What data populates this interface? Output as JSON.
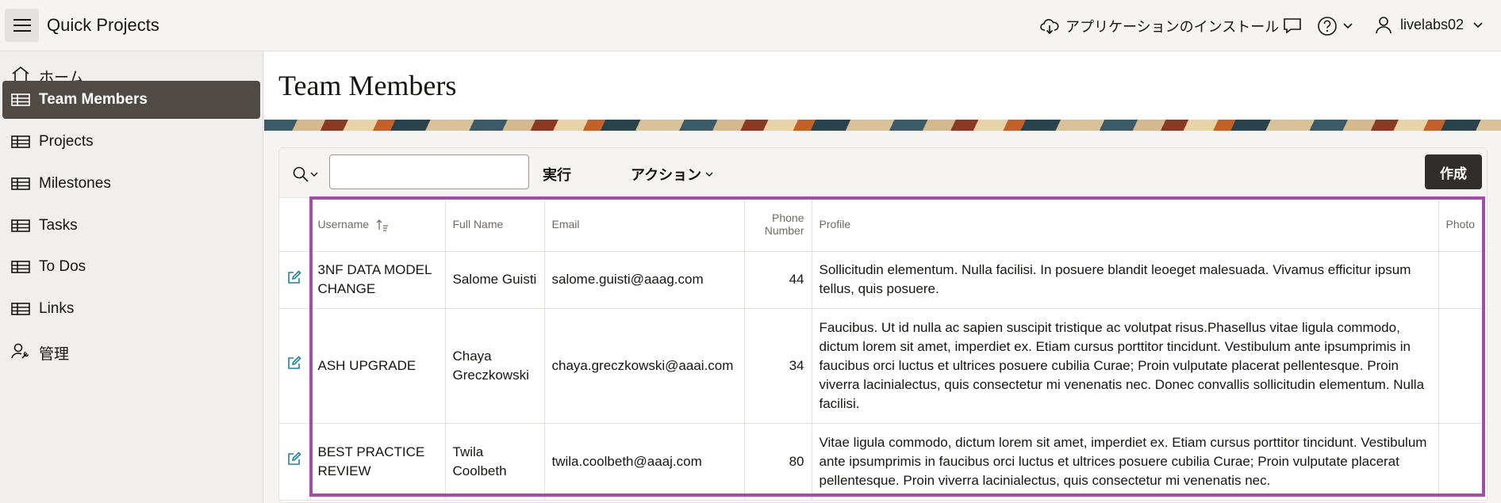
{
  "header": {
    "app_title": "Quick Projects",
    "install_label": "アプリケーションのインストール",
    "username": "livelabs02"
  },
  "sidebar": {
    "items": [
      {
        "label": "ホーム",
        "icon": "home-icon",
        "active": false
      },
      {
        "label": "Team Members",
        "icon": "table-icon",
        "active": true
      },
      {
        "label": "Projects",
        "icon": "table-icon",
        "active": false
      },
      {
        "label": "Milestones",
        "icon": "table-icon",
        "active": false
      },
      {
        "label": "Tasks",
        "icon": "table-icon",
        "active": false
      },
      {
        "label": "To Dos",
        "icon": "table-icon",
        "active": false
      },
      {
        "label": "Links",
        "icon": "table-icon",
        "active": false
      },
      {
        "label": "管理",
        "icon": "user-wrench-icon",
        "active": false
      }
    ]
  },
  "main": {
    "page_title": "Team Members"
  },
  "toolbar": {
    "search_value": "",
    "go_label": "実行",
    "actions_label": "アクション",
    "create_label": "作成"
  },
  "table": {
    "columns": [
      "Username",
      "Full Name",
      "Email",
      "Phone Number",
      "Profile",
      "Photo"
    ],
    "rows": [
      {
        "username": "3NF DATA MODEL CHANGE",
        "full_name": "Salome Guisti",
        "email": "salome.guisti@aaag.com",
        "phone": "44",
        "profile": "Sollicitudin elementum. Nulla facilisi. In posuere blandit leoeget malesuada. Vivamus efficitur ipsum tellus, quis posuere."
      },
      {
        "username": "ASH UPGRADE",
        "full_name": "Chaya Greczkowski",
        "email": "chaya.greczkowski@aaai.com",
        "phone": "34",
        "profile": "Faucibus. Ut id nulla ac sapien suscipit tristique ac volutpat risus.Phasellus vitae ligula commodo, dictum lorem sit amet, imperdiet ex. Etiam cursus porttitor tincidunt. Vestibulum ante ipsumprimis in faucibus orci luctus et ultrices posuere cubilia Curae; Proin vulputate placerat pellentesque. Proin viverra lacinialectus, quis consectetur mi venenatis nec. Donec convallis sollicitudin elementum. Nulla facilisi."
      },
      {
        "username": "BEST PRACTICE REVIEW",
        "full_name": "Twila Coolbeth",
        "email": "twila.coolbeth@aaaj.com",
        "phone": "80",
        "profile": "Vitae ligula commodo, dictum lorem sit amet, imperdiet ex. Etiam cursus porttitor tincidunt. Vestibulum ante ipsumprimis in faucibus orci luctus et ultrices posuere cubilia Curae; Proin vulputate placerat pellentesque. Proin viverra lacinialectus, quis consectetur mi venenatis nec."
      }
    ]
  },
  "colors": {
    "active_nav_bg": "#4f4a44",
    "create_button_bg": "#312d2a",
    "edit_icon": "#227e9e",
    "highlight_border": "#a24ea8"
  }
}
